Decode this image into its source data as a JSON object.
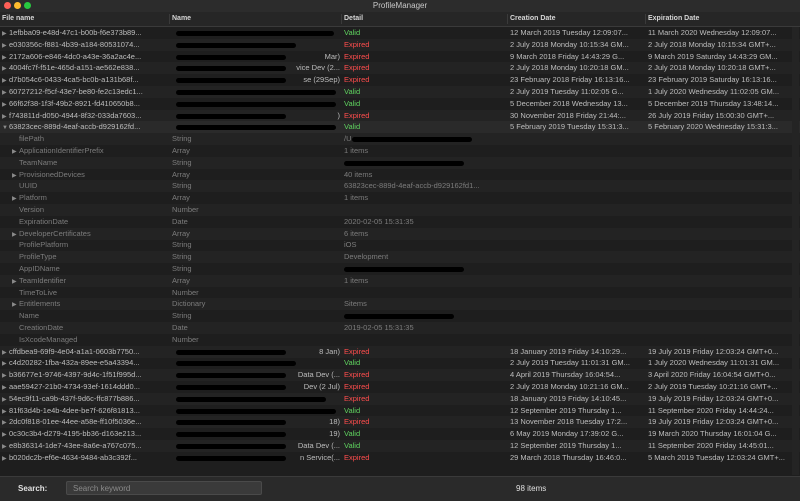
{
  "window": {
    "title": "ProfileManager"
  },
  "columns": [
    "File name",
    "Name",
    "Detail",
    "Creation Date",
    "Expiration Date"
  ],
  "rows": [
    {
      "type": "profile",
      "file": "1efbba09-e48d-47c1-b00b-f6e373b89...",
      "name": "",
      "detail": "Valid",
      "status": "valid",
      "created": "12 March 2019 Tuesday 12:09:07...",
      "expires": "11 March 2020 Wednesday 12:09:07..."
    },
    {
      "type": "profile",
      "file": "e030356c-f881-4b39-a184-80531074...",
      "name": "",
      "detail": "Expired",
      "status": "expired",
      "created": "2 July 2018 Monday 10:15:34 GM...",
      "expires": "2 July 2018 Monday 10:15:34 GMT+..."
    },
    {
      "type": "profile",
      "file": "2172a606-e846-4dc0-a43e-36a2ac4e...",
      "name": "Mar)",
      "detail": "Expired",
      "status": "expired",
      "created": "9 March 2018 Friday 14:43:29 G...",
      "expires": "9 March 2019 Saturday 14:43:29 GM..."
    },
    {
      "type": "profile",
      "file": "4004fc7f-f51e-465d-a151-ae562e838...",
      "name": "vice Dev (2...",
      "detail": "Expired",
      "status": "expired",
      "created": "2 July 2018 Monday 10:20:18 GM...",
      "expires": "2 July 2018 Monday 10:20:18 GMT+..."
    },
    {
      "type": "profile",
      "file": "d7b054c6-0433-4ca5-bc0b-a131b68f...",
      "name": "se (29Sep)",
      "detail": "Expired",
      "status": "expired",
      "created": "23 February 2018 Friday 16:13:16...",
      "expires": "23 February 2019 Saturday 16:13:16..."
    },
    {
      "type": "profile",
      "file": "60727212-f5cf-43e7-be80-fe2c13edc1...",
      "name": "",
      "detail": "Valid",
      "status": "valid",
      "created": "2 July 2019 Tuesday 11:02:05 G...",
      "expires": "1 July 2020 Wednesday 11:02:05 GM..."
    },
    {
      "type": "profile",
      "file": "66f62f38-1f3f-49b2-8921-fd410650b8...",
      "name": "",
      "detail": "Valid",
      "status": "valid",
      "created": "5 December 2018 Wednesday 13...",
      "expires": "5 December 2019 Thursday 13:48:14..."
    },
    {
      "type": "profile",
      "file": "f743811d-d050-4944-8f32-033da7603...",
      "name": ")",
      "detail": "Expired",
      "status": "expired",
      "created": "30 November 2018 Friday 21:44:...",
      "expires": "26 July 2019 Friday 15:00:30 GMT+..."
    },
    {
      "type": "profile-expanded",
      "file": "63823cec-889d-4eaf-accb-d929162fd...",
      "name": "",
      "detail": "Valid",
      "status": "valid",
      "created": "5 February 2019 Tuesday 15:31:3...",
      "expires": "5 February 2020 Wednesday 15:31:3..."
    },
    {
      "type": "child",
      "file": "filePath",
      "name": "String",
      "detail": "/U",
      "created": "",
      "expires": ""
    },
    {
      "type": "child",
      "file": "ApplicationIdentifierPrefix",
      "name": "Array",
      "detail": "1 items",
      "created": "",
      "expires": "",
      "tri": true
    },
    {
      "type": "child",
      "file": "TeamName",
      "name": "String",
      "detail": "",
      "created": "",
      "expires": ""
    },
    {
      "type": "child",
      "file": "ProvisionedDevices",
      "name": "Array",
      "detail": "40 items",
      "created": "",
      "expires": "",
      "tri": true
    },
    {
      "type": "child",
      "file": "UUID",
      "name": "String",
      "detail": "63823cec-889d-4eaf-accb-d929162fd1...",
      "created": "",
      "expires": ""
    },
    {
      "type": "child",
      "file": "Platform",
      "name": "Array",
      "detail": "1 items",
      "created": "",
      "expires": "",
      "tri": true
    },
    {
      "type": "child",
      "file": "Version",
      "name": "Number",
      "detail": "",
      "created": "",
      "expires": ""
    },
    {
      "type": "child",
      "file": "ExpirationDate",
      "name": "Date",
      "detail": "2020-02-05 15:31:35",
      "created": "",
      "expires": ""
    },
    {
      "type": "child",
      "file": "DeveloperCertificates",
      "name": "Array",
      "detail": "6 items",
      "created": "",
      "expires": "",
      "tri": true
    },
    {
      "type": "child",
      "file": "ProfilePlatform",
      "name": "String",
      "detail": "iOS",
      "created": "",
      "expires": ""
    },
    {
      "type": "child",
      "file": "ProfileType",
      "name": "String",
      "detail": "Development",
      "created": "",
      "expires": ""
    },
    {
      "type": "child",
      "file": "AppIDName",
      "name": "String",
      "detail": "",
      "created": "",
      "expires": ""
    },
    {
      "type": "child",
      "file": "TeamIdentifier",
      "name": "Array",
      "detail": "1 items",
      "created": "",
      "expires": "",
      "tri": true
    },
    {
      "type": "child",
      "file": "TimeToLive",
      "name": "Number",
      "detail": "",
      "created": "",
      "expires": ""
    },
    {
      "type": "child",
      "file": "Entitlements",
      "name": "Dictionary",
      "detail": "Sitems",
      "created": "",
      "expires": "",
      "tri": true
    },
    {
      "type": "child",
      "file": "Name",
      "name": "String",
      "detail": "",
      "created": "",
      "expires": ""
    },
    {
      "type": "child",
      "file": "CreationDate",
      "name": "Date",
      "detail": "2019-02-05 15:31:35",
      "created": "",
      "expires": ""
    },
    {
      "type": "child",
      "file": "IsXcodeManaged",
      "name": "Number",
      "detail": "",
      "created": "",
      "expires": ""
    },
    {
      "type": "profile",
      "file": "cffdbea9-69f9-4e04-a1a1-0603b7750...",
      "name": "8 Jan)",
      "detail": "Expired",
      "status": "expired",
      "created": "18 January 2019 Friday 14:10:29...",
      "expires": "19 July 2019 Friday 12:03:24 GMT+0..."
    },
    {
      "type": "profile",
      "file": "c4d20282-1fba-432a-89ee-e5a43394...",
      "name": "",
      "detail": "Valid",
      "status": "valid",
      "created": "2 July 2019 Tuesday 11:01:31 GM...",
      "expires": "1 July 2020 Wednesday 11:01:31 GM..."
    },
    {
      "type": "profile",
      "file": "b36677e1-9746-4397-9d4c-1f51f995d...",
      "name": "Data Dev (...",
      "detail": "Expired",
      "status": "expired",
      "created": "4 April 2019 Thursday 16:04:54...",
      "expires": "3 April 2020 Friday 16:04:54 GMT+0..."
    },
    {
      "type": "profile",
      "file": "aae59427-21b0-4734-93ef-1614ddd0...",
      "name": "Dev (2 Jul)",
      "detail": "Expired",
      "status": "expired",
      "created": "2 July 2018 Monday 10:21:16 GM...",
      "expires": "2 July 2019 Tuesday 10:21:16 GMT+..."
    },
    {
      "type": "profile",
      "file": "54ec9f11-ca9b-437f-9d6c-ffc877b886...",
      "name": "",
      "detail": "Expired",
      "status": "expired",
      "created": "18 January 2019 Friday 14:10:45...",
      "expires": "19 July 2019 Friday 12:03:24 GMT+0..."
    },
    {
      "type": "profile",
      "file": "81f63d4b-1e4b-4dee-be7f-626f81813...",
      "name": "",
      "detail": "Valid",
      "status": "valid",
      "created": "12 September 2019 Thursday 1...",
      "expires": "11 September 2020 Friday 14:44:24..."
    },
    {
      "type": "profile",
      "file": "2dc0f818-01ee-44ee-a58e-ff10f5036e...",
      "name": "18)",
      "detail": "Expired",
      "status": "expired",
      "created": "13 November 2018 Tuesday 17:2...",
      "expires": "19 July 2019 Friday 12:03:24 GMT+0..."
    },
    {
      "type": "profile",
      "file": "0c30c3b4-d279-4195-bb36-d163e213...",
      "name": "19)",
      "detail": "Valid",
      "status": "valid",
      "created": "6 May 2019 Monday 17:39:02 G...",
      "expires": "19 March 2020 Thursday 16:01:04 G..."
    },
    {
      "type": "profile",
      "file": "e8b36314-1de7-43ee-8a6e-a767c075...",
      "name": "Data Dev (...",
      "detail": "Valid",
      "status": "valid",
      "created": "12 September 2019 Thursday 1...",
      "expires": "11 September 2020 Friday 14:45:01..."
    },
    {
      "type": "profile",
      "file": "b020dc2b-ef6e-4634-9484-ab3c392f...",
      "name": "n Service(...",
      "detail": "Expired",
      "status": "expired",
      "created": "29 March 2018 Thursday 16:46:0...",
      "expires": "5 March 2019 Tuesday 12:03:24 GMT+..."
    }
  ],
  "footer": {
    "search_label": "Search:",
    "search_placeholder": "Search keyword",
    "count": "98 items"
  },
  "colors": {
    "valid": "#5fd35f",
    "expired": "#ff4d4d",
    "background": "#1e1e1e"
  }
}
